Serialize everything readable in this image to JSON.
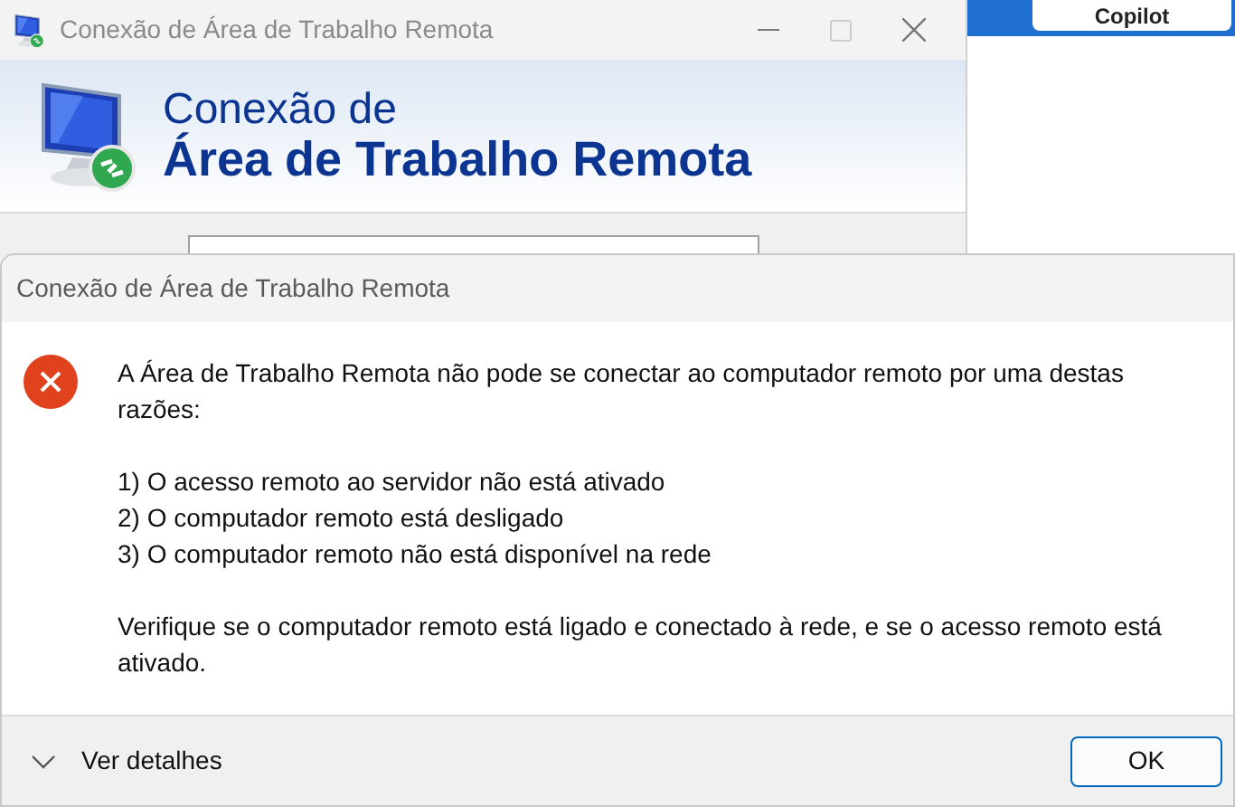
{
  "background_window": {
    "title": "Conexão de Área de Trabalho Remota",
    "banner_line_1": "Conexão de",
    "banner_line_2": "Área de Trabalho Remota"
  },
  "copilot_button": {
    "label": "Copilot"
  },
  "dialog": {
    "title": "Conexão de Área de Trabalho Remota",
    "paragraphs": [
      "A Área de Trabalho Remota não pode se conectar ao computador remoto por uma destas razões:"
    ],
    "reasons": [
      "1) O acesso remoto ao servidor não está ativado",
      "2) O computador remoto está desligado",
      "3) O computador remoto não está disponível na rede"
    ],
    "advice": "Verifique se o computador remoto está ligado e conectado à rede, e se o acesso remoto está ativado.",
    "details": {
      "label": "Ver detalhes",
      "expanded": false
    },
    "ok_button": "OK"
  }
}
